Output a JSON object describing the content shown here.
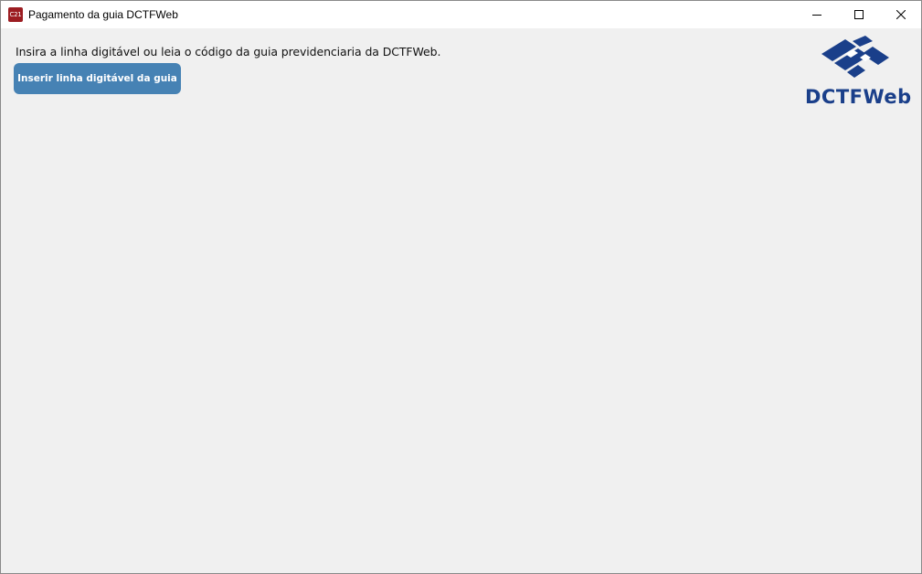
{
  "window": {
    "title": "Pagamento da guia DCTFWeb",
    "app_icon_text": "C21",
    "app_icon_color": "#9c1d22",
    "controls": {
      "minimize": "minimize-icon",
      "maximize": "maximize-icon",
      "close": "close-icon"
    }
  },
  "main": {
    "instruction": "Insira a linha digitável ou leia o código da guia previdenciaria da DCTFWeb.",
    "insert_button_label": "Inserir linha digitável da guia",
    "button_color": "#4682b4"
  },
  "logo": {
    "text": "DCTFWeb",
    "color": "#1a3f8a",
    "icon": "receita-federal-emblem"
  }
}
